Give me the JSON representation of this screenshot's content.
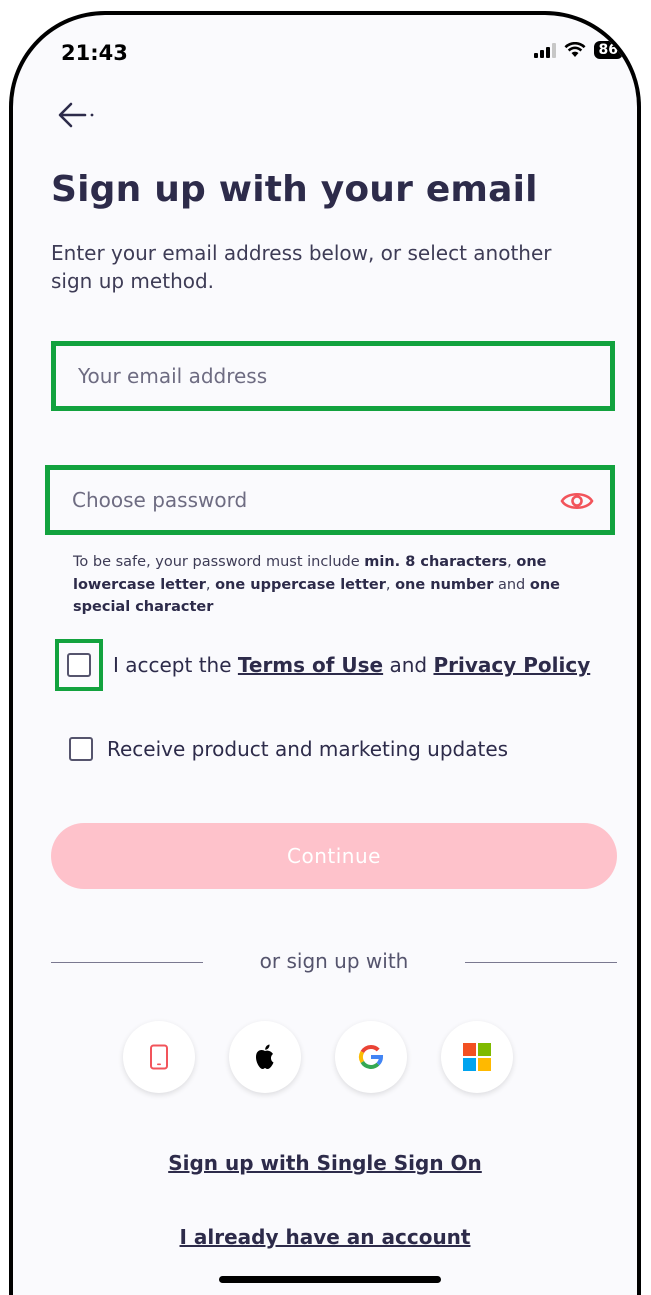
{
  "status_bar": {
    "time": "21:43",
    "battery": "86"
  },
  "header": {
    "title": "Sign up with your email",
    "subtitle": "Enter your email address below, or select another sign up method."
  },
  "form": {
    "email_placeholder": "Your email address",
    "password_placeholder": "Choose password",
    "hint": {
      "p1": "To be safe, your password must include ",
      "b1": "min. 8 characters",
      "p2": ", ",
      "b2": "one lowercase letter",
      "p3": ", ",
      "b3": "one uppercase letter",
      "p4": ", ",
      "b4": "one number",
      "p5": " and ",
      "b5": "one special character"
    },
    "terms": {
      "prefix": "I accept the ",
      "terms_link": "Terms of Use",
      "middle": " and ",
      "privacy_link": "Privacy Policy"
    },
    "marketing_label": "Receive product and marketing updates",
    "continue_label": "Continue"
  },
  "alt": {
    "divider_text": "or sign up with",
    "sso_link": "Sign up with Single Sign On",
    "have_account_link": "I already have an account"
  },
  "colors": {
    "accent": "#f2545b",
    "continue_disabled": "#fec2cb",
    "highlight_box": "#12a23e",
    "text_primary": "#2d2b4a"
  },
  "icons": [
    "back-arrow-icon",
    "eye-icon",
    "phone-icon",
    "apple-icon",
    "google-icon",
    "microsoft-icon"
  ]
}
